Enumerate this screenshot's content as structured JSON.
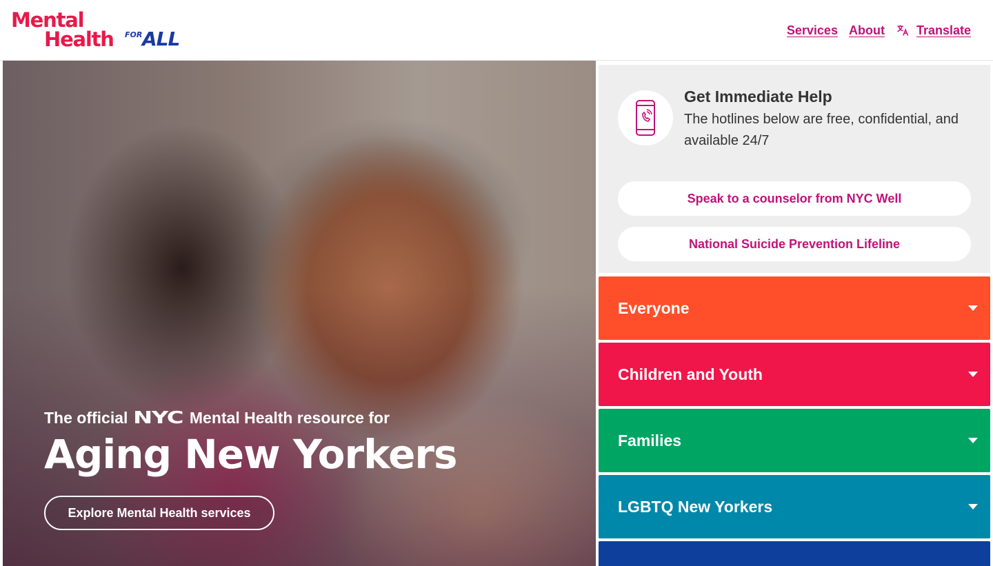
{
  "header": {
    "logo": {
      "line1": "Mental",
      "line2": "Health",
      "for": "FOR",
      "all": "ALL"
    },
    "nav": {
      "services": "Services",
      "about": "About",
      "translate": "Translate"
    }
  },
  "hero": {
    "kicker_prefix": "The official",
    "kicker_logo": "NYC",
    "kicker_suffix": "Mental Health resource for",
    "title": "Aging New Yorkers",
    "button": "Explore Mental Health services"
  },
  "help": {
    "icon": "phone-icon",
    "title": "Get Immediate Help",
    "description": "The hotlines below are free, confidential, and available 24/7",
    "buttons": [
      {
        "label": "Speak to a counselor from NYC Well"
      },
      {
        "label": "National Suicide Prevention Lifeline"
      }
    ]
  },
  "categories": [
    {
      "label": "Everyone",
      "color": "#ff4e2a"
    },
    {
      "label": "Children and Youth",
      "color": "#f0164a"
    },
    {
      "label": "Families",
      "color": "#00a564"
    },
    {
      "label": "LGBTQ New Yorkers",
      "color": "#0088aa"
    },
    {
      "label": "",
      "color": "#0e3f9c"
    }
  ],
  "colors": {
    "accent": "#c0127a",
    "brand_red": "#e8194a",
    "brand_blue": "#1a3aa0"
  }
}
